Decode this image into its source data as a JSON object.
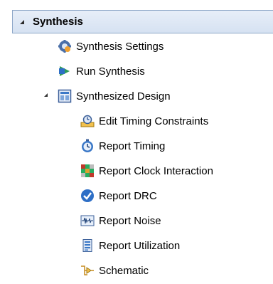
{
  "section": {
    "title": "Synthesis"
  },
  "items": {
    "settings": "Synthesis Settings",
    "run": "Run Synthesis",
    "design": "Synthesized Design",
    "timing_constraints": "Edit Timing Constraints",
    "report_timing": "Report Timing",
    "clock_interaction": "Report Clock Interaction",
    "drc": "Report DRC",
    "noise": "Report Noise",
    "utilization": "Report Utilization",
    "schematic": "Schematic"
  },
  "colors": {
    "header_bg": "#dde7f4",
    "header_border": "#8ea7c8",
    "accent_blue": "#2e6fc6",
    "run_green": "#2e9b5a"
  }
}
